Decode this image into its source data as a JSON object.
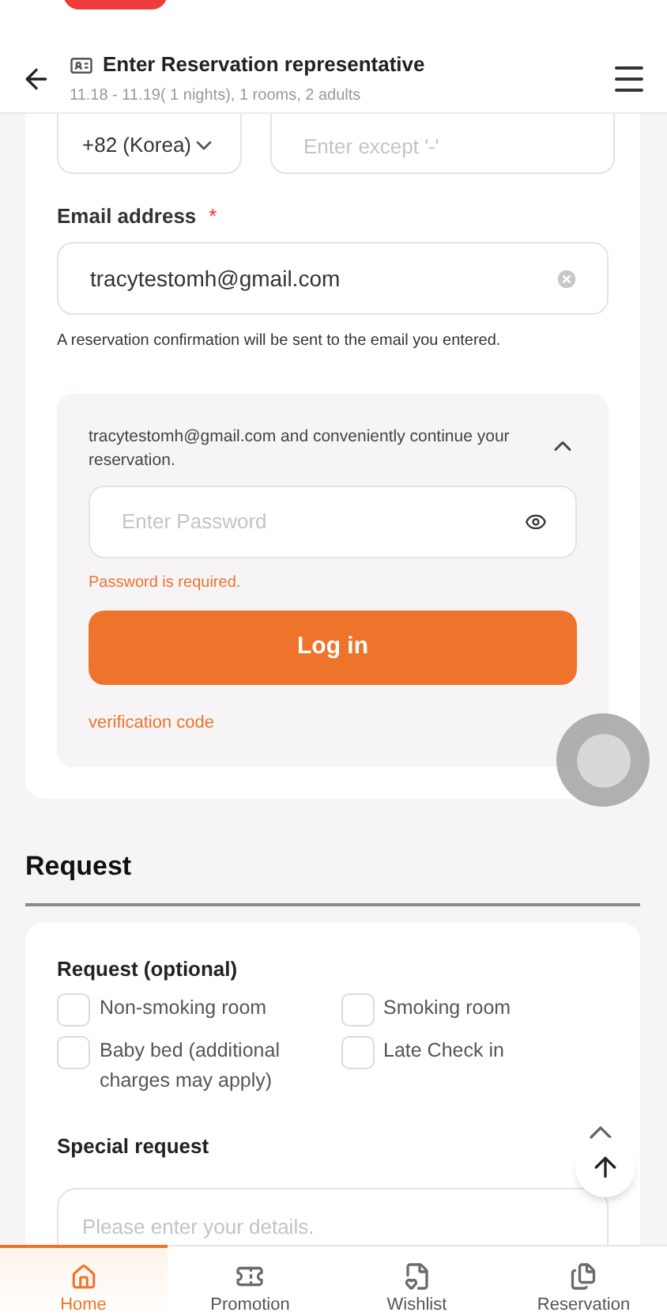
{
  "header": {
    "title": "Enter Reservation representative",
    "subtitle": "11.18 - 11.19( 1 nights), 1 rooms, 2 adults"
  },
  "phone": {
    "country": "+82 (Korea)",
    "placeholder": "Enter except '-'"
  },
  "email": {
    "label": "Email address",
    "required": true,
    "required_mark": "*",
    "value": "tracytestomh@gmail.com",
    "hint": "A reservation confirmation will be sent to the email you entered."
  },
  "login": {
    "message": "tracytestomh@gmail.com and conveniently continue your reservation.",
    "expanded": true,
    "password_placeholder": "Enter Password",
    "error": "Password is required.",
    "button": "Log in",
    "link": "verification code"
  },
  "request": {
    "heading": "Request",
    "section_label": "Request (optional)",
    "options": [
      {
        "label": "Non-smoking room",
        "checked": false
      },
      {
        "label": "Smoking room",
        "checked": false
      },
      {
        "label": "Baby bed (additional charges may apply)",
        "checked": false
      },
      {
        "label": "Late Check in",
        "checked": false
      }
    ],
    "special_label": "Special request",
    "special_expanded": true,
    "special_placeholder": "Please enter your details."
  },
  "nav": [
    {
      "label": "Home",
      "kind": "home",
      "selected": true
    },
    {
      "label": "Promotion",
      "kind": "promotion",
      "selected": false
    },
    {
      "label": "Wishlist",
      "kind": "wishlist",
      "selected": false
    },
    {
      "label": "Reservation",
      "kind": "reservation",
      "selected": false
    }
  ]
}
